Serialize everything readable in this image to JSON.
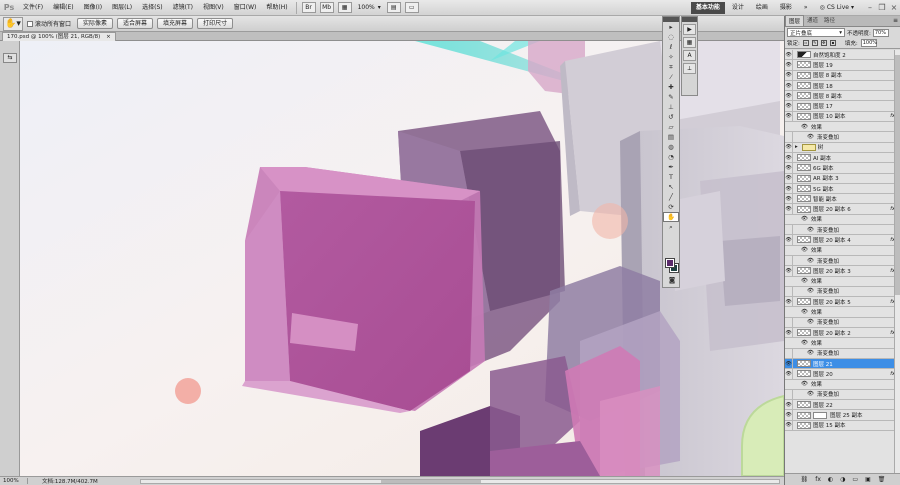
{
  "app": {
    "logo": "Ps"
  },
  "menu": [
    "文件(F)",
    "编辑(E)",
    "图像(I)",
    "图层(L)",
    "选择(S)",
    "滤镜(T)",
    "视图(V)",
    "窗口(W)",
    "帮助(H)"
  ],
  "zoom_display": "100%",
  "workspaces": [
    "基本功能",
    "设计",
    "绘画",
    "摄影"
  ],
  "workspace_more": "»",
  "cs_live": "CS Live",
  "options": {
    "scroll_all_label": "滚动所有窗口",
    "buttons": [
      "实际像素",
      "适合屏幕",
      "填充屏幕",
      "打印尺寸"
    ]
  },
  "document": {
    "tab_title": "170.psd @ 100% (图层 21, RGB/8)",
    "close": "×"
  },
  "status": {
    "zoom": "100%",
    "doc_info": "文档:128.7M/402.7M"
  },
  "layers_panel": {
    "tabs": [
      "图层",
      "通道",
      "路径"
    ],
    "blend_mode": "正片叠底",
    "opacity_label": "不透明度:",
    "opacity": "70%",
    "lock_label": "锁定:",
    "fill_label": "填充:",
    "fill": "100%",
    "effects_label": "效果",
    "fx_label": "fx",
    "items": [
      {
        "name": "自然饱和度 2",
        "kind": "adjust",
        "fx": false
      },
      {
        "name": "图层 19",
        "kind": "layer",
        "fx": false
      },
      {
        "name": "图层 8 副本",
        "kind": "layer",
        "fx": false
      },
      {
        "name": "图层 18",
        "kind": "layer",
        "fx": false
      },
      {
        "name": "图层 8 副本",
        "kind": "layer",
        "fx": false
      },
      {
        "name": "图层 17",
        "kind": "layer",
        "fx": false
      },
      {
        "name": "图层 10 副本",
        "kind": "layer",
        "fx": true
      },
      {
        "name": "效果",
        "kind": "effect-head"
      },
      {
        "name": "渐变叠加",
        "kind": "effect-item"
      },
      {
        "name": "树",
        "kind": "group",
        "fx": false
      },
      {
        "name": "AI 副本",
        "kind": "layer",
        "fx": false
      },
      {
        "name": "6G 副本",
        "kind": "layer",
        "fx": false
      },
      {
        "name": "AR 副本 3",
        "kind": "layer",
        "fx": false
      },
      {
        "name": "5G 副本",
        "kind": "layer",
        "fx": false
      },
      {
        "name": "智能 副本",
        "kind": "layer",
        "fx": false
      },
      {
        "name": "图层 20 副本 6",
        "kind": "layer",
        "fx": true
      },
      {
        "name": "效果",
        "kind": "effect-head"
      },
      {
        "name": "渐变叠加",
        "kind": "effect-item"
      },
      {
        "name": "图层 20 副本 4",
        "kind": "layer",
        "fx": true
      },
      {
        "name": "效果",
        "kind": "effect-head"
      },
      {
        "name": "渐变叠加",
        "kind": "effect-item"
      },
      {
        "name": "图层 20 副本 3",
        "kind": "layer",
        "fx": true
      },
      {
        "name": "效果",
        "kind": "effect-head"
      },
      {
        "name": "渐变叠加",
        "kind": "effect-item"
      },
      {
        "name": "图层 20 副本 5",
        "kind": "layer",
        "fx": true
      },
      {
        "name": "效果",
        "kind": "effect-head"
      },
      {
        "name": "渐变叠加",
        "kind": "effect-item"
      },
      {
        "name": "图层 20 副本 2",
        "kind": "layer",
        "fx": true
      },
      {
        "name": "效果",
        "kind": "effect-head"
      },
      {
        "name": "渐变叠加",
        "kind": "effect-item"
      },
      {
        "name": "图层 21",
        "kind": "layer",
        "fx": false,
        "selected": true
      },
      {
        "name": "图层 20",
        "kind": "layer",
        "fx": true
      },
      {
        "name": "效果",
        "kind": "effect-head"
      },
      {
        "name": "渐变叠加",
        "kind": "effect-item"
      },
      {
        "name": "图层 22",
        "kind": "layer",
        "fx": false
      },
      {
        "name": "图层 25 副本",
        "kind": "mask",
        "fx": false
      },
      {
        "name": "图层 15 副本",
        "kind": "layer",
        "fx": false
      }
    ]
  },
  "colors": {
    "foreground": "#5a2a6a",
    "background": "#1d4040",
    "selected_layer": "#3d8ee6"
  }
}
